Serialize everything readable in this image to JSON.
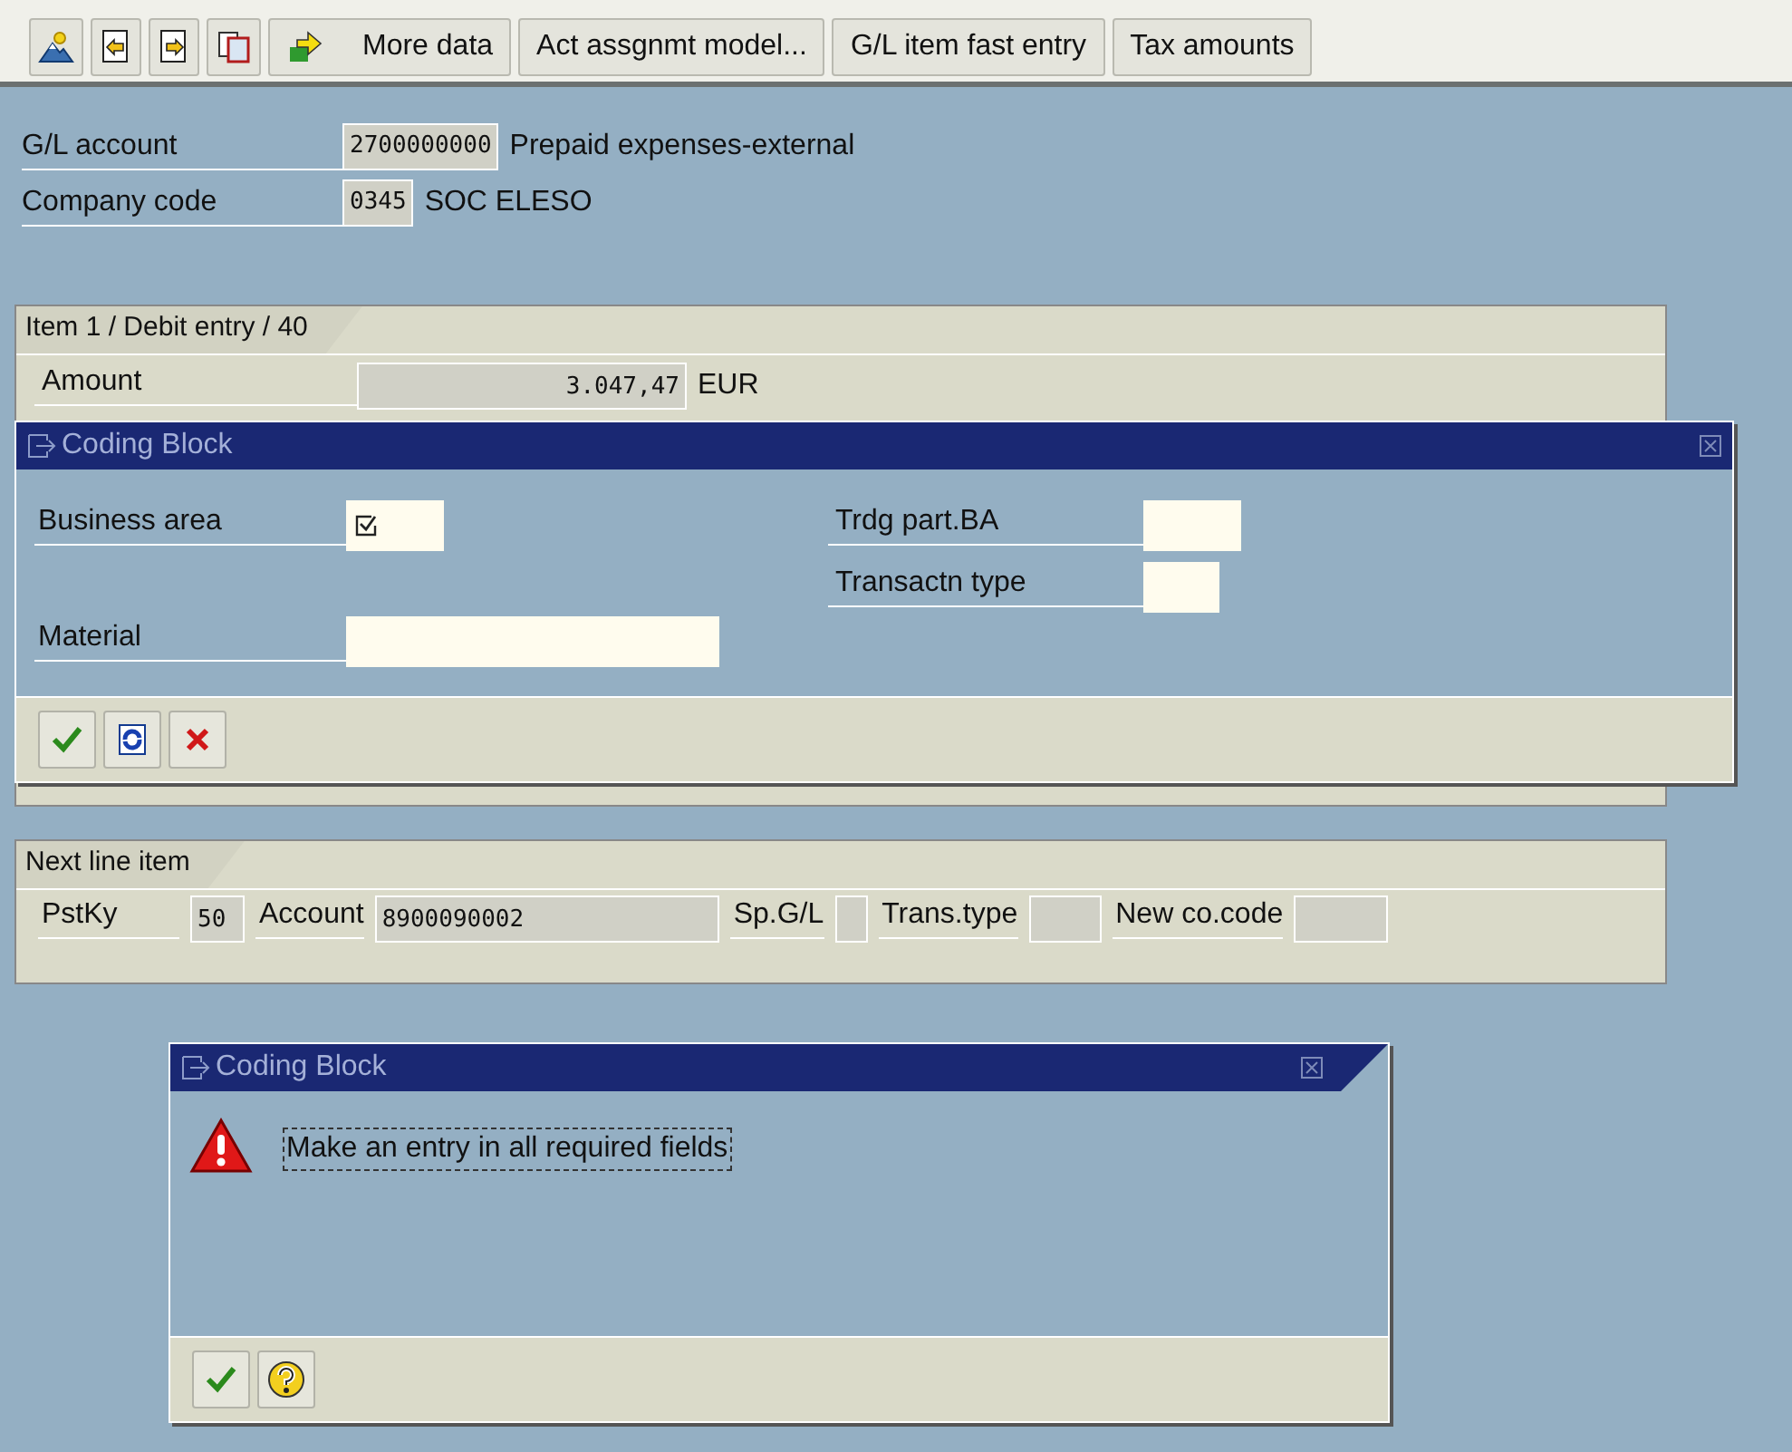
{
  "toolbar": {
    "buttons": [
      {
        "label": "More data",
        "kind": "icon-text"
      },
      {
        "label": "Act assgnmt model...",
        "kind": "text"
      },
      {
        "label": "G/L item fast entry",
        "kind": "text"
      },
      {
        "label": "Tax amounts",
        "kind": "text"
      }
    ]
  },
  "header": {
    "fields": [
      {
        "label": "G/L account",
        "value": "2700000000",
        "description": "Prepaid expenses-external"
      },
      {
        "label": "Company code",
        "value": "0345",
        "description": "SOC ELESO"
      }
    ]
  },
  "item_panel": {
    "tab": "Item 1 / Debit entry / 40",
    "amount": {
      "label": "Amount",
      "value": "3.047,47",
      "currency": "EUR"
    }
  },
  "coding_block": {
    "title": "Coding Block",
    "left_fields": [
      {
        "label": "Business area",
        "required": true
      },
      {
        "label": "Material",
        "required": false
      }
    ],
    "right_fields": [
      {
        "label": "Trdg part.BA",
        "required": false
      },
      {
        "label": "Transactn type",
        "required": false
      }
    ]
  },
  "next_line_item": {
    "tab": "Next line item",
    "fields": [
      {
        "label": "PstKy",
        "value": "50"
      },
      {
        "label": "Account",
        "value": "8900090002"
      },
      {
        "label": "Sp.G/L"
      },
      {
        "label": "Trans.type"
      },
      {
        "label": "New co.code"
      }
    ]
  },
  "message_dialog": {
    "title": "Coding Block",
    "message": "Make an entry in all required fields"
  }
}
